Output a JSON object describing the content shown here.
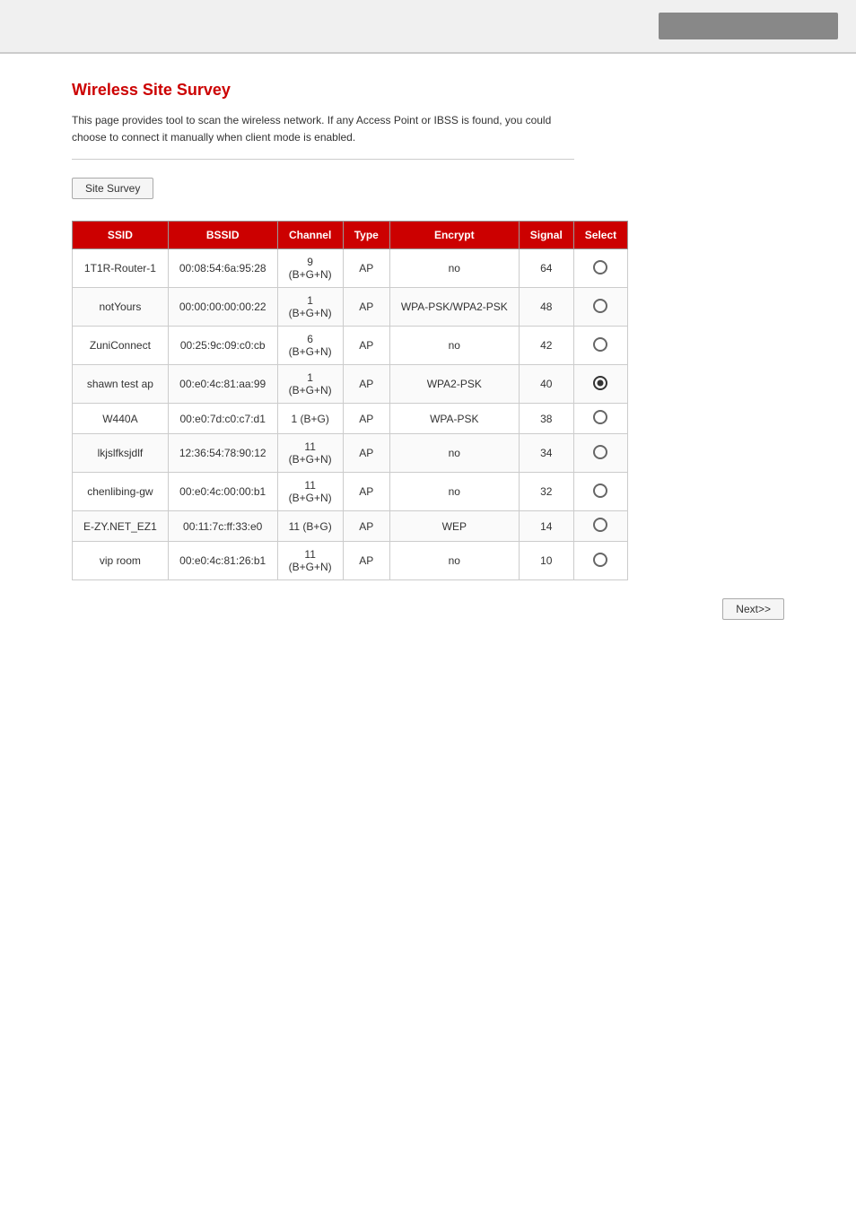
{
  "topBar": {
    "rightBarColor": "#888"
  },
  "page": {
    "title": "Wireless Site Survey",
    "description": "This page provides tool to scan the wireless network. If any Access Point or IBSS is found, you could choose to connect it manually when client mode is enabled.",
    "siteSurveyButton": "Site Survey",
    "nextButton": "Next>>"
  },
  "table": {
    "headers": [
      "SSID",
      "BSSID",
      "Channel",
      "Type",
      "Encrypt",
      "Signal",
      "Select"
    ],
    "rows": [
      {
        "ssid": "1T1R-Router-1",
        "bssid": "00:08:54:6a:95:28",
        "channel": "9\n(B+G+N)",
        "type": "AP",
        "encrypt": "no",
        "signal": "64",
        "selected": false
      },
      {
        "ssid": "notYours",
        "bssid": "00:00:00:00:00:22",
        "channel": "1\n(B+G+N)",
        "type": "AP",
        "encrypt": "WPA-PSK/WPA2-PSK",
        "signal": "48",
        "selected": false
      },
      {
        "ssid": "ZuniConnect",
        "bssid": "00:25:9c:09:c0:cb",
        "channel": "6\n(B+G+N)",
        "type": "AP",
        "encrypt": "no",
        "signal": "42",
        "selected": false
      },
      {
        "ssid": "shawn test ap",
        "bssid": "00:e0:4c:81:aa:99",
        "channel": "1\n(B+G+N)",
        "type": "AP",
        "encrypt": "WPA2-PSK",
        "signal": "40",
        "selected": true
      },
      {
        "ssid": "W440A",
        "bssid": "00:e0:7d:c0:c7:d1",
        "channel": "1 (B+G)",
        "type": "AP",
        "encrypt": "WPA-PSK",
        "signal": "38",
        "selected": false
      },
      {
        "ssid": "lkjslfksjdlf",
        "bssid": "12:36:54:78:90:12",
        "channel": "11\n(B+G+N)",
        "type": "AP",
        "encrypt": "no",
        "signal": "34",
        "selected": false
      },
      {
        "ssid": "chenlibing-gw",
        "bssid": "00:e0:4c:00:00:b1",
        "channel": "11\n(B+G+N)",
        "type": "AP",
        "encrypt": "no",
        "signal": "32",
        "selected": false
      },
      {
        "ssid": "E-ZY.NET_EZ1",
        "bssid": "00:11:7c:ff:33:e0",
        "channel": "11 (B+G)",
        "type": "AP",
        "encrypt": "WEP",
        "signal": "14",
        "selected": false
      },
      {
        "ssid": "vip room",
        "bssid": "00:e0:4c:81:26:b1",
        "channel": "11\n(B+G+N)",
        "type": "AP",
        "encrypt": "no",
        "signal": "10",
        "selected": false
      }
    ]
  }
}
